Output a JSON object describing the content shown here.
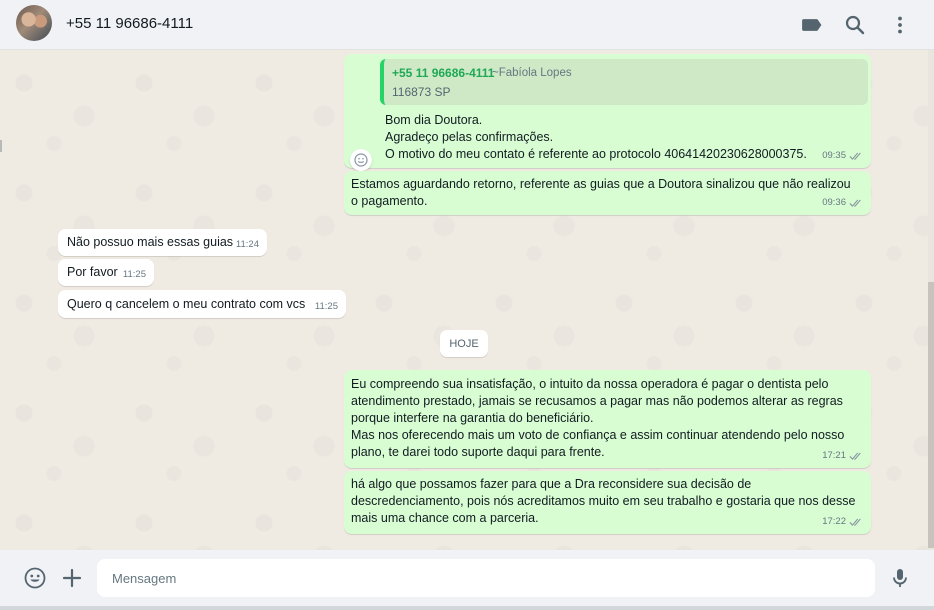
{
  "header": {
    "contact_name": "+55 11 96686-4111",
    "icons": [
      "label-icon",
      "search-icon",
      "menu-icon"
    ]
  },
  "messages": [
    {
      "direction": "outgoing",
      "quote": {
        "sender": "+55 11 96686-4111",
        "alias": "~Fabíola Lopes",
        "text": "116873 SP"
      },
      "lines": [
        "Bom dia Doutora.",
        "Agradeço pelas confirmações.",
        "O motivo do meu contato é referente ao protocolo 40641420230628000375."
      ],
      "time": "09:35",
      "status": "read"
    },
    {
      "direction": "outgoing",
      "lines": [
        "Estamos aguardando retorno, referente as guias que a Doutora sinalizou que não realizou",
        "o pagamento."
      ],
      "time": "09:36",
      "status": "read"
    },
    {
      "direction": "incoming",
      "lines": [
        "Não possuo mais essas guias"
      ],
      "time": "11:24"
    },
    {
      "direction": "incoming",
      "lines": [
        "Por favor"
      ],
      "time": "11:25"
    },
    {
      "direction": "incoming",
      "lines": [
        "Quero q cancelem o meu contrato com vcs"
      ],
      "time": "11:25"
    },
    {
      "direction": "outgoing",
      "lines": [
        "Eu compreendo sua insatisfação, o intuito da nossa operadora é pagar o dentista pelo",
        "atendimento prestado, jamais se recusamos a pagar mas não podemos alterar as regras",
        "porque interfere na garantia do beneficiário.",
        "Mas nos oferecendo mais um voto de confiança e assim continuar atendendo pelo nosso",
        "plano, te darei todo suporte daqui para frente."
      ],
      "time": "17:21",
      "status": "read"
    },
    {
      "direction": "outgoing",
      "lines": [
        "há algo que possamos fazer para que a Dra reconsidere sua decisão de",
        "descredenciamento, pois nós acreditamos muito em seu trabalho e gostaria que nos desse",
        "mais uma chance com a parceria."
      ],
      "time": "17:22",
      "status": "read"
    }
  ],
  "date_divider": "HOJE",
  "footer": {
    "placeholder": "Mensagem",
    "icons": [
      "emoji-icon",
      "plus-icon",
      "microphone-icon"
    ]
  },
  "colors": {
    "outgoing_bubble": "#d9fdd3",
    "incoming_bubble": "#ffffff",
    "chat_background": "#efeae2",
    "bar_background": "#f0f2f5",
    "quote_accent": "#25d366",
    "read_ticks": "#8696a0"
  }
}
